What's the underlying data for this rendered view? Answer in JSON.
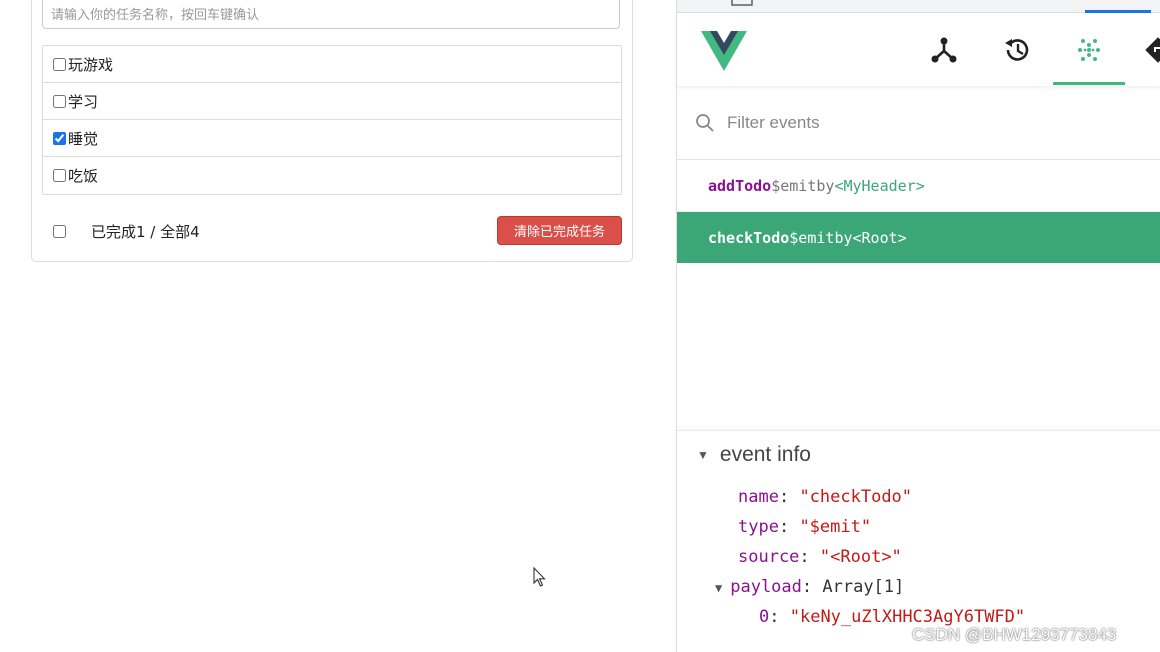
{
  "todo": {
    "input_placeholder": "请输入你的任务名称，按回车键确认",
    "items": [
      {
        "label": "玩游戏",
        "done": false
      },
      {
        "label": "学习",
        "done": false
      },
      {
        "label": "睡觉",
        "done": true
      },
      {
        "label": "吃饭",
        "done": false
      }
    ],
    "footer": {
      "summary": "已完成1 / 全部4",
      "clear_label": "清除已完成任务"
    }
  },
  "devtools": {
    "nav_icons": [
      "components-tree-icon",
      "history-icon",
      "events-icon",
      "router-icon"
    ],
    "filter_placeholder": "Filter events",
    "events": [
      {
        "name": "addTodo",
        "kind": "$emit",
        "by": "by",
        "source": "<MyHeader>",
        "selected": false
      },
      {
        "name": "checkTodo",
        "kind": "$emit",
        "by": "by",
        "source": "<Root>",
        "selected": true
      }
    ],
    "event_info": {
      "title": "event info",
      "name_key": "name",
      "name_val": "\"checkTodo\"",
      "type_key": "type",
      "type_val": "\"$emit\"",
      "source_key": "source",
      "source_val": "\"<Root>\"",
      "payload_key": "payload",
      "payload_val": "Array[1]",
      "item0_key": "0",
      "item0_val": "\"keNy_uZlXHHC3AgY6TWFD\""
    },
    "accent": "#42b883",
    "selected_row_color": "#3ba776"
  },
  "watermark": "CSDN @BHW1293773843"
}
